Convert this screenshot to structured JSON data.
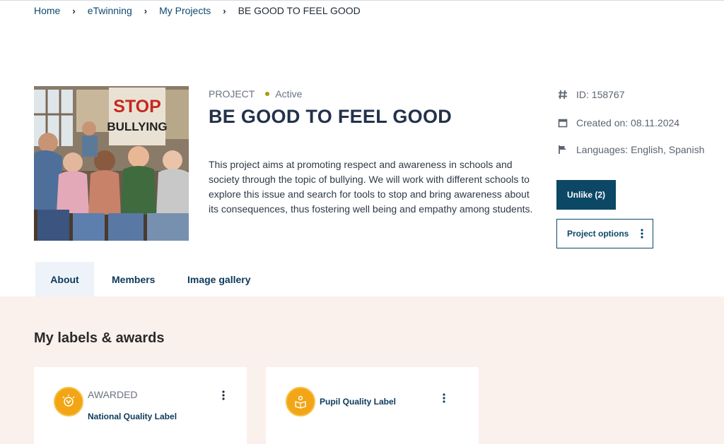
{
  "breadcrumb": {
    "items": [
      "Home",
      "eTwinning",
      "My Projects"
    ],
    "current": "BE GOOD TO FEEL GOOD",
    "separator": "›"
  },
  "project": {
    "kind": "PROJECT",
    "status": "Active",
    "status_color": "#a89a10",
    "title": "BE GOOD TO FEEL GOOD",
    "description": "This project aims at promoting respect and awareness in schools and society through the topic of bullying. We will work with different schools to explore this issue and search for tools to stop and bring awareness about its consequences, thus fostering well being and empathy among students.",
    "image_sign_line1": "STOP",
    "image_sign_line2": "BULLYING"
  },
  "info": {
    "id": "ID: 158767",
    "created": "Created on: 08.11.2024",
    "languages": "Languages: English, Spanish",
    "icons": [
      "hash-icon",
      "calendar-icon",
      "flag-icon"
    ]
  },
  "actions": {
    "unlike": "Unlike (2)",
    "options": "Project options"
  },
  "tabs": [
    {
      "label": "About",
      "active": true
    },
    {
      "label": "Members",
      "active": false
    },
    {
      "label": "Image gallery",
      "active": false
    }
  ],
  "labels_section": {
    "title": "My labels & awards",
    "cards": [
      {
        "status": "AWARDED",
        "name": "National Quality Label",
        "icon": "award-medal-icon"
      },
      {
        "status": "",
        "name": "Pupil Quality Label",
        "icon": "pupil-book-icon"
      }
    ]
  },
  "colors": {
    "primary": "#0c4766",
    "link": "#0d4a6e",
    "badge": "#f2a515",
    "lower_bg": "#faf0ec",
    "tab_active_bg": "#edf3f9"
  }
}
